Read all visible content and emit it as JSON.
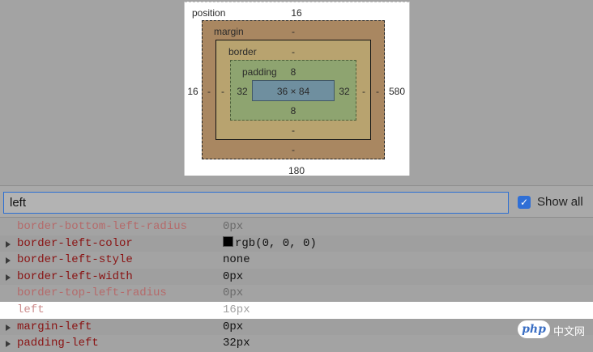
{
  "box_model": {
    "position_label": "position",
    "position_top": "16",
    "position_left": "16",
    "position_right": "580",
    "position_bottom": "180",
    "margin_label": "margin",
    "margin_top": "-",
    "margin_left": "-",
    "margin_right": "-",
    "margin_bottom": "-",
    "border_label": "border",
    "border_top": "-",
    "border_left": "-",
    "border_right": "-",
    "border_bottom": "-",
    "padding_label": "padding",
    "padding_top": "8",
    "padding_left": "32",
    "padding_right": "32",
    "padding_bottom": "8",
    "content_size": "36 × 84"
  },
  "filter": {
    "value": "left",
    "show_all_label": "Show all",
    "show_all_checked": true
  },
  "properties": [
    {
      "name": "border-bottom-left-radius",
      "value": "0px",
      "expandable": false,
      "inherited": true
    },
    {
      "name": "border-left-color",
      "value": "rgb(0, 0, 0)",
      "expandable": true,
      "color_swatch": "#000000"
    },
    {
      "name": "border-left-style",
      "value": "none",
      "expandable": true
    },
    {
      "name": "border-left-width",
      "value": "0px",
      "expandable": true
    },
    {
      "name": "border-top-left-radius",
      "value": "0px",
      "expandable": false,
      "inherited": true
    },
    {
      "name": "left",
      "value": "16px",
      "expandable": false,
      "selected": true
    },
    {
      "name": "margin-left",
      "value": "0px",
      "expandable": true
    },
    {
      "name": "padding-left",
      "value": "32px",
      "expandable": true
    }
  ],
  "watermark": {
    "logo_text": "php",
    "site_text": "中文网"
  }
}
